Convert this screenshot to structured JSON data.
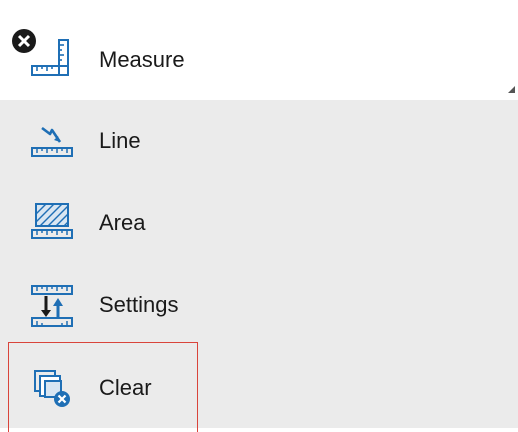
{
  "header": {
    "title": "Measure"
  },
  "menu": {
    "items": [
      {
        "label": "Line",
        "icon": "line-measure-icon"
      },
      {
        "label": "Area",
        "icon": "area-measure-icon"
      },
      {
        "label": "Settings",
        "icon": "settings-measure-icon"
      },
      {
        "label": "Clear",
        "icon": "clear-measure-icon"
      }
    ]
  },
  "colors": {
    "icon_blue": "#1f6fb5",
    "highlight_border": "#d9443b",
    "menu_bg": "#ebebeb"
  }
}
